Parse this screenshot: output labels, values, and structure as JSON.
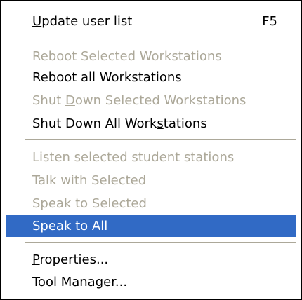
{
  "menu": {
    "update_user_list": {
      "pre": "",
      "key": "U",
      "post": "pdate user list",
      "shortcut": "F5"
    },
    "reboot_selected": {
      "pre": "Reboot Selected Workstations",
      "key": "",
      "post": ""
    },
    "reboot_all": {
      "pre": "Reboot all Workstations",
      "key": "",
      "post": ""
    },
    "shutdown_selected": {
      "pre": "Shut ",
      "key": "D",
      "post": "own Selected Workstations"
    },
    "shutdown_all": {
      "pre": "Shut Down All Work",
      "key": "s",
      "post": "tations"
    },
    "listen_selected": {
      "pre": "Listen selected student stations",
      "key": "",
      "post": ""
    },
    "talk_selected": {
      "pre": "Talk with Selected",
      "key": "",
      "post": ""
    },
    "speak_selected": {
      "pre": "Speak to Selected",
      "key": "",
      "post": ""
    },
    "speak_all": {
      "pre": "Speak to All",
      "key": "",
      "post": ""
    },
    "properties": {
      "pre": "",
      "key": "P",
      "post": "roperties..."
    },
    "tool_manager": {
      "pre": "Tool ",
      "key": "M",
      "post": "anager..."
    }
  },
  "colors": {
    "highlight": "#316ac5",
    "disabled_text": "#aca899",
    "border": "#000000"
  }
}
